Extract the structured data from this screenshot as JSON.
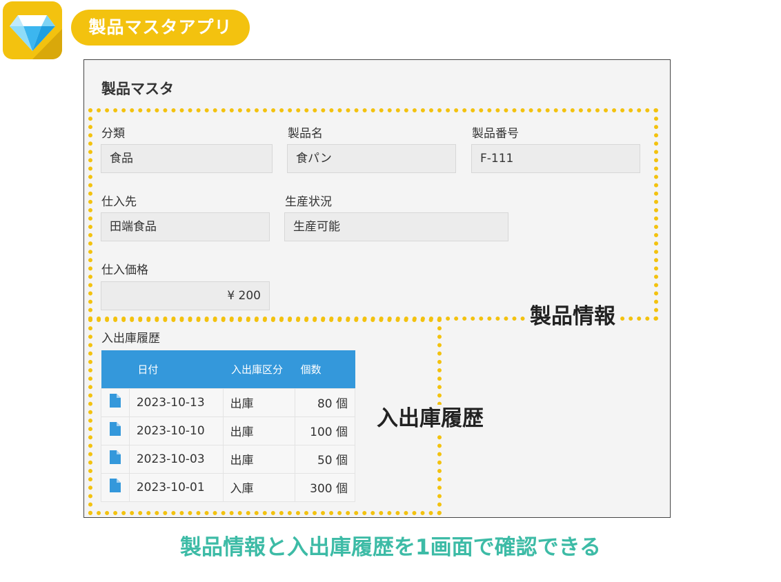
{
  "app": {
    "name": "製品マスタアプリ",
    "icon": "diamond-icon",
    "accent_color": "#f3c20f"
  },
  "form": {
    "title": "製品マスタ",
    "fields": {
      "category": {
        "label": "分類",
        "value": "食品"
      },
      "product_name": {
        "label": "製品名",
        "value": "食パン"
      },
      "product_number": {
        "label": "製品番号",
        "value": "F-111"
      },
      "supplier": {
        "label": "仕入先",
        "value": "田端食品"
      },
      "production_status": {
        "label": "生産状況",
        "value": "生産可能"
      },
      "purchase_price": {
        "label": "仕入価格",
        "value": "¥ 200"
      }
    }
  },
  "history": {
    "label": "入出庫履歴",
    "header_color": "#3498db",
    "columns": [
      "",
      "日付",
      "入出庫区分",
      "個数"
    ],
    "rows": [
      {
        "icon": "document-icon",
        "date": "2023-10-13",
        "type": "出庫",
        "qty": "80 個"
      },
      {
        "icon": "document-icon",
        "date": "2023-10-10",
        "type": "出庫",
        "qty": "100 個"
      },
      {
        "icon": "document-icon",
        "date": "2023-10-03",
        "type": "出庫",
        "qty": "50 個"
      },
      {
        "icon": "document-icon",
        "date": "2023-10-01",
        "type": "入庫",
        "qty": "300 個"
      }
    ]
  },
  "annotations": {
    "product_info": "製品情報",
    "history": "入出庫履歴",
    "caption": "製品情報と入出庫履歴を1画面で確認できる",
    "caption_color": "#3dbba6"
  }
}
